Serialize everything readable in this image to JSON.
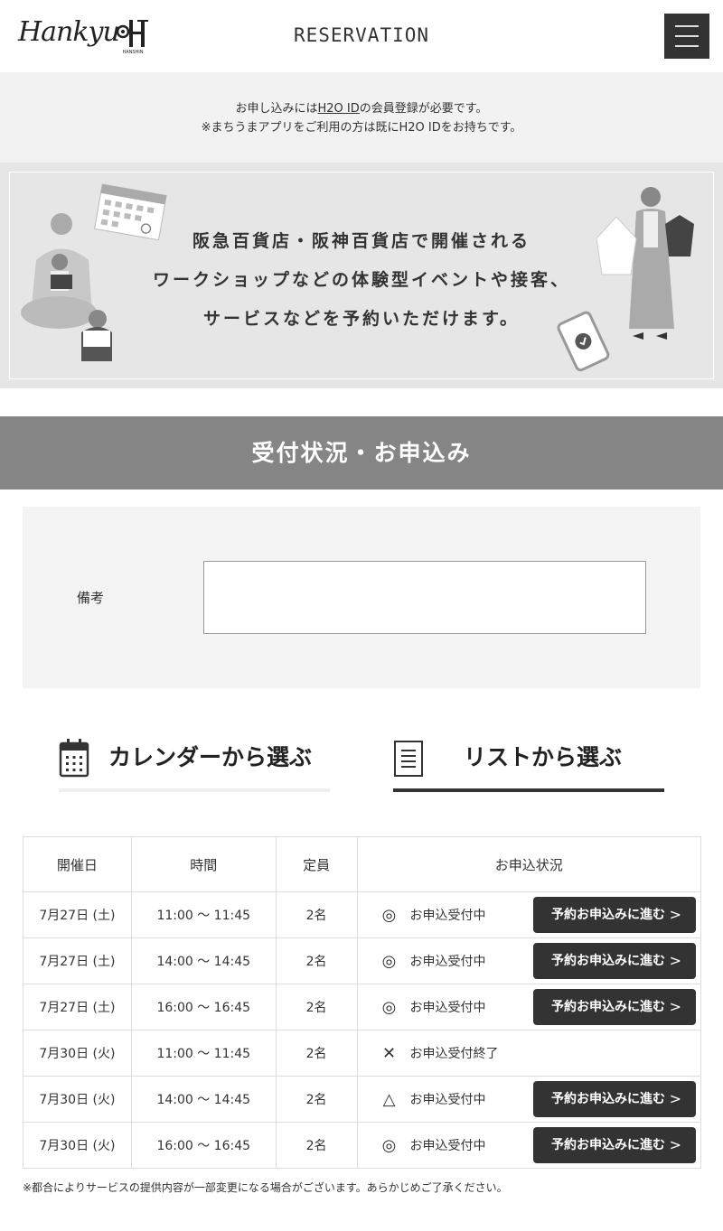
{
  "header": {
    "logo_hankyu": "Hankyu",
    "logo_hanshin": "HANSHIN",
    "title": "RESERVATION"
  },
  "notice": {
    "line1_pre": "お申し込みには",
    "line1_link": "H2O ID",
    "line1_post": "の会員登録が必要です。",
    "line2": "※まちうまアプリをご利用の方は既にH2O IDをお持ちです。"
  },
  "hero": {
    "line1": "阪急百貨店・阪神百貨店で開催される",
    "line2": "ワークショップなどの体験型イベントや接客、",
    "line3": "サービスなどを予約いただけます。"
  },
  "section": {
    "title": "受付状況・お申込み"
  },
  "form": {
    "remarks_label": "備考",
    "remarks_value": ""
  },
  "tabs": {
    "calendar_label": "カレンダーから選ぶ",
    "list_label": "リストから選ぶ"
  },
  "table": {
    "headers": [
      "開催日",
      "時間",
      "定員",
      "お申込状況"
    ],
    "rows": [
      {
        "date": "7月27日 (土)",
        "time": "11:00 ～ 11:45",
        "capacity": "2名",
        "mark": "◎",
        "status": "お申込受付中",
        "button": "予約お申込みに進む"
      },
      {
        "date": "7月27日 (土)",
        "time": "14:00 ～ 14:45",
        "capacity": "2名",
        "mark": "◎",
        "status": "お申込受付中",
        "button": "予約お申込みに進む"
      },
      {
        "date": "7月27日 (土)",
        "time": "16:00 ～ 16:45",
        "capacity": "2名",
        "mark": "◎",
        "status": "お申込受付中",
        "button": "予約お申込みに進む"
      },
      {
        "date": "7月30日 (火)",
        "time": "11:00 ～ 11:45",
        "capacity": "2名",
        "mark": "✕",
        "status": "お申込受付終了",
        "button": ""
      },
      {
        "date": "7月30日 (火)",
        "time": "14:00 ～ 14:45",
        "capacity": "2名",
        "mark": "△",
        "status": "お申込受付中",
        "button": "予約お申込みに進む"
      },
      {
        "date": "7月30日 (火)",
        "time": "16:00 ～ 16:45",
        "capacity": "2名",
        "mark": "◎",
        "status": "お申込受付中",
        "button": "予約お申込みに進む"
      }
    ]
  },
  "footnote": "※都合によりサービスの提供内容が一部変更になる場合がございます。あらかじめご了承ください。",
  "colors": {
    "dark": "#333333",
    "section_bar": "#858585",
    "panel_bg": "#f3f3f3"
  }
}
